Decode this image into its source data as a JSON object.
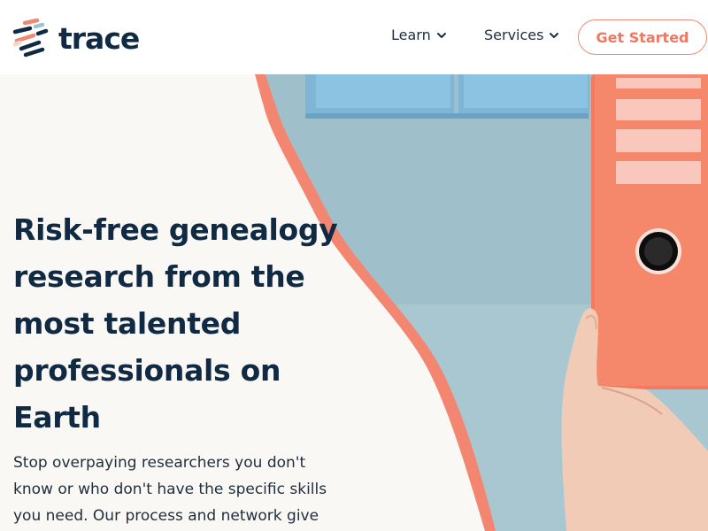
{
  "brand": {
    "name": "trace",
    "accent_color": "#f07860",
    "navy_color": "#102a43"
  },
  "nav": {
    "learn_label": "Learn",
    "services_label": "Services",
    "cta_label": "Get Started"
  },
  "hero": {
    "headline": "Risk-free genealogy research from the most talented professionals on Earth",
    "subtext": "Stop overpaying researchers you don't know or who don't have the specific skills you need. Our process and network give"
  },
  "icons": {
    "logo": "trace-stripes-logo-icon",
    "learn_dropdown": "chevron-down-icon",
    "services_dropdown": "chevron-down-icon"
  }
}
